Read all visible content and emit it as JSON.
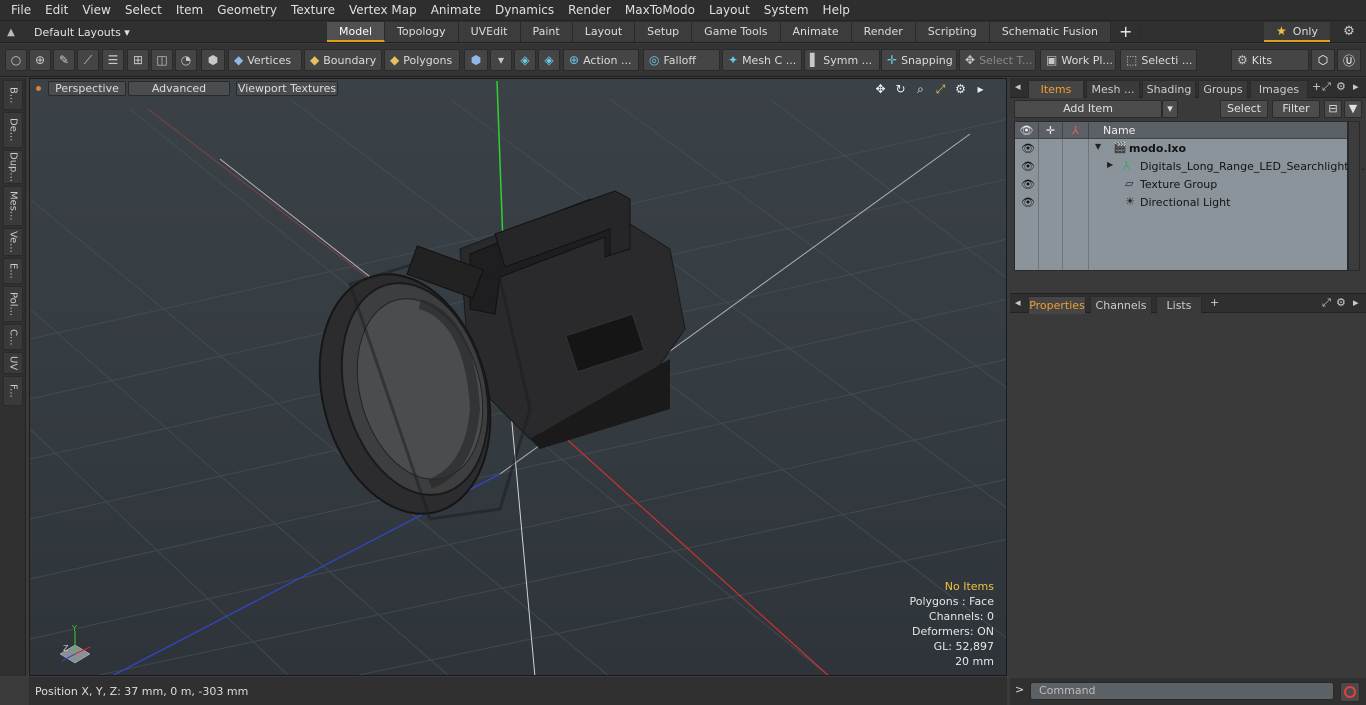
{
  "menu": [
    "File",
    "Edit",
    "View",
    "Select",
    "Item",
    "Geometry",
    "Texture",
    "Vertex Map",
    "Animate",
    "Dynamics",
    "Render",
    "MaxToModo",
    "Layout",
    "System",
    "Help"
  ],
  "layouts": {
    "label": "Default Layouts ▾"
  },
  "mode_tabs": [
    "Model",
    "Topology",
    "UVEdit",
    "Paint",
    "Layout",
    "Setup",
    "Game Tools",
    "Animate",
    "Render",
    "Scripting",
    "Schematic Fusion"
  ],
  "active_mode_tab": "Model",
  "only_label": "Only",
  "toolbar": {
    "vertices": "Vertices",
    "boundary": "Boundary",
    "polygons": "Polygons",
    "action": "Action ...",
    "falloff": "Falloff",
    "mesh": "Mesh C ...",
    "symm": "Symm ...",
    "snapping": "Snapping",
    "select_t": "Select T...",
    "work_pl": "Work Pl...",
    "selecti": "Selecti ...",
    "kits": "Kits"
  },
  "left_tabs": [
    "B...",
    "De...",
    "Dup...",
    "Mes...",
    "Ve...",
    "E...",
    "Pol...",
    "C...",
    "UV",
    "F..."
  ],
  "viewport": {
    "perspective": "Perspective",
    "advanced": "Advanced",
    "textures": "Viewport Textures",
    "info": {
      "items": "No Items",
      "polygons": "Polygons : Face",
      "channels": "Channels: 0",
      "deformers": "Deformers: ON",
      "gl": "GL: 52,897",
      "scale": "20 mm"
    }
  },
  "status": {
    "position": "Position X, Y, Z:   37 mm, 0 m, -303 mm"
  },
  "panel": {
    "tabs": [
      "Items",
      "Mesh ...",
      "Shading",
      "Groups",
      "Images"
    ],
    "active_tab": "Items",
    "add_item": "Add Item",
    "select": "Select",
    "filter": "Filter",
    "name_col": "Name",
    "tree": [
      {
        "label": "modo.lxo",
        "bold": true
      },
      {
        "label": "Digitals_Long_Range_LED_Searchlight_ ..."
      },
      {
        "label": "Texture Group"
      },
      {
        "label": "Directional Light"
      }
    ],
    "prop_tabs": [
      "Properties",
      "Channels",
      "Lists"
    ],
    "active_prop_tab": "Properties",
    "command_placeholder": "Command"
  },
  "colors": {
    "accent": "#e0a020",
    "axis_x": "#c03030",
    "axis_y": "#30c030",
    "axis_z": "#3050c0"
  }
}
